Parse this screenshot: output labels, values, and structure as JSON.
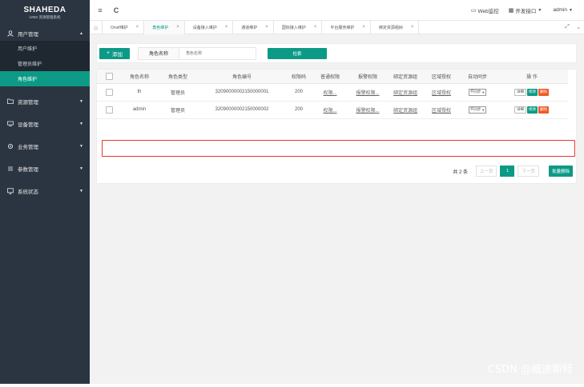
{
  "logo": {
    "main": "SHAHEDA",
    "sub": "iVMS 资源管理系统"
  },
  "sidebar": {
    "groups": [
      {
        "label": "用户管理",
        "icon": "user-icon",
        "caret": "▲",
        "items": [
          {
            "label": "用户维护"
          },
          {
            "label": "管理员维护"
          },
          {
            "label": "角色维护",
            "active": true
          }
        ]
      },
      {
        "label": "资源管理",
        "icon": "folder-icon",
        "caret": "▼"
      },
      {
        "label": "设备管理",
        "icon": "device-icon",
        "caret": "▼"
      },
      {
        "label": "业务管理",
        "icon": "gear-icon",
        "caret": "▼"
      },
      {
        "label": "参数管理",
        "icon": "sliders-icon",
        "caret": "▼"
      },
      {
        "label": "系统状态",
        "icon": "monitor-icon",
        "caret": "▼"
      }
    ]
  },
  "topbar": {
    "menu_icon": "≡",
    "refresh_icon": "C",
    "web_monitor": "Web监控",
    "dev_interface": "开发接口",
    "user": "admin"
  },
  "tabs": [
    {
      "label": "Onvif维护"
    },
    {
      "label": "角色维护",
      "active": true
    },
    {
      "label": "设备接入维护"
    },
    {
      "label": "通道维护"
    },
    {
      "label": "国标接入维护"
    },
    {
      "label": "平台服务维护"
    },
    {
      "label": "绑定资源组树"
    }
  ],
  "search": {
    "add_label": "添加",
    "field_label": "角色名称",
    "placeholder": "角色名称",
    "search_label": "检索"
  },
  "table": {
    "headers": [
      "角色名称",
      "角色类型",
      "角色编号",
      "权限码",
      "普通权限",
      "报警权限",
      "绑定资源组",
      "区域授权",
      "自动同步",
      "操 作"
    ],
    "rows": [
      {
        "name": "th",
        "type": "管理员",
        "code": "32090000002150000001",
        "perm": "200",
        "normal": "权限...",
        "alarm": "报警权限...",
        "group": "绑定资源组",
        "area": "区域授权",
        "sync": "不同步",
        "ops": [
          "详细",
          "修改",
          "删除"
        ]
      },
      {
        "name": "admin",
        "type": "管理员",
        "code": "32090000002150000002",
        "perm": "200",
        "normal": "权限...",
        "alarm": "报警权限...",
        "group": "绑定资源组",
        "area": "区域授权",
        "sync": "不同步",
        "ops": [
          "详细",
          "修改",
          "删除"
        ]
      }
    ]
  },
  "pager": {
    "total": "共 2 条",
    "prev": "上一页",
    "current": "1",
    "next": "下一页",
    "batch": "批量删除"
  },
  "watermark": "CSDN @威迪斯特",
  "colors": {
    "accent": "#0c9a86",
    "danger": "#f05a28",
    "highlight": "#e8382d",
    "sidebar": "#2b3541"
  }
}
